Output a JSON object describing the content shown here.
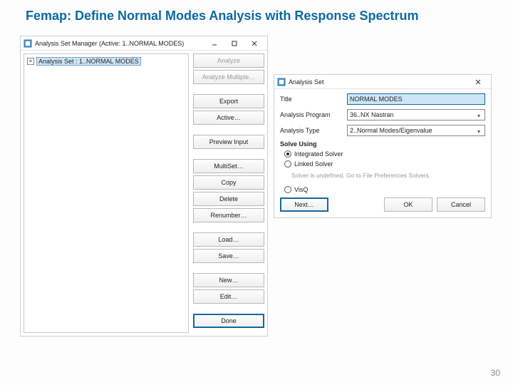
{
  "slide": {
    "title": "Femap:   Define Normal Modes Analysis with Response Spectrum",
    "page_number": "30"
  },
  "manager": {
    "window_title": "Analysis Set Manager (Active: 1..NORMAL MODES)",
    "tree": {
      "item_label": "Analysis Set : 1..NORMAL MODES"
    },
    "buttons": {
      "analyze": "Analyze",
      "analyze_multiple": "Analyze Multiple…",
      "export": "Export",
      "active": "Active…",
      "preview_input": "Preview Input",
      "multiset": "MultiSet…",
      "copy": "Copy",
      "delete": "Delete",
      "renumber": "Renumber…",
      "load": "Load…",
      "save": "Save…",
      "new": "New…",
      "edit": "Edit…",
      "done": "Done"
    }
  },
  "dialog": {
    "window_title": "Analysis Set",
    "fields": {
      "title_label": "Title",
      "title_value": "NORMAL MODES",
      "program_label": "Analysis Program",
      "program_value": "36..NX Nastran",
      "type_label": "Analysis Type",
      "type_value": "2..Normal Modes/Eigenvalue"
    },
    "solve_using": {
      "group_label": "Solve Using",
      "integrated": "Integrated Solver",
      "linked": "Linked Solver",
      "hint": "Solver is undefined. Go to File Preferences Solvers.",
      "visq": "VisQ"
    },
    "buttons": {
      "next": "Next…",
      "ok": "OK",
      "cancel": "Cancel"
    }
  }
}
